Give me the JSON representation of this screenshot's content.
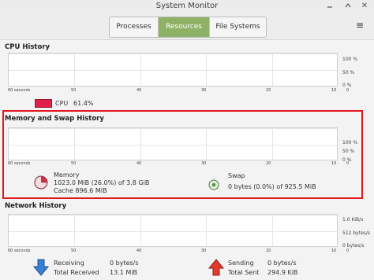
{
  "window": {
    "title": "System Monitor",
    "close_glyph": "✕"
  },
  "tabs": [
    "Processes",
    "Resources",
    "File Systems"
  ],
  "menu_glyph": "≡",
  "cpu": {
    "title": "CPU History",
    "y_ticks": [
      "100 %",
      "50 %",
      "0 %"
    ],
    "x_ticks": [
      "60 seconds",
      "50",
      "40",
      "30",
      "20",
      "10",
      "0"
    ],
    "legend_label": "CPU",
    "legend_value": "61.4%",
    "color": "#e0204a"
  },
  "memory": {
    "title": "Memory and Swap History",
    "y_ticks": [
      "100 %",
      "50 %",
      "0 %"
    ],
    "x_ticks": [
      "60 seconds",
      "50",
      "40",
      "30",
      "20",
      "10",
      "0"
    ],
    "mem_label": "Memory",
    "mem_value": "1023.0 MiB (26.0%) of 3.8 GiB",
    "mem_cache": "Cache 896.6 MiB",
    "mem_fraction": 0.26,
    "mem_color": "#c0344a",
    "swap_label": "Swap",
    "swap_value": "0 bytes (0.0%) of 925.5 MiB",
    "swap_color": "#4a9a3a"
  },
  "network": {
    "title": "Network History",
    "y_ticks": [
      "1.0 KiB/s",
      "512 bytes/s",
      "0 bytes/s"
    ],
    "x_ticks": [
      "60 seconds",
      "50",
      "40",
      "30",
      "20",
      "10",
      "0"
    ],
    "receiving_label": "Receiving",
    "receiving_value": "0 bytes/s",
    "total_received_label": "Total Received",
    "total_received_value": "13.1 MiB",
    "sending_label": "Sending",
    "sending_value": "0 bytes/s",
    "total_sent_label": "Total Sent",
    "total_sent_value": "294.9 KiB",
    "receive_color": "#3b7fd4",
    "send_color": "#e23b2e"
  }
}
